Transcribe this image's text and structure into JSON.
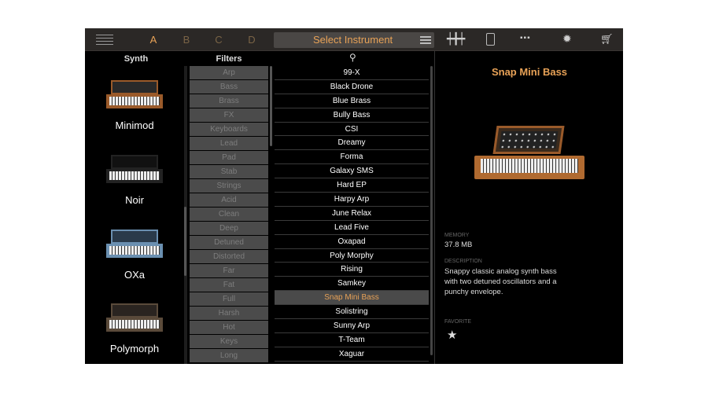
{
  "topbar": {
    "menu_icon": "menu-lines-icon",
    "preset_tabs": [
      "A",
      "B",
      "C",
      "D"
    ],
    "active_tab": "A",
    "select_instrument": "Select Instrument",
    "icons": [
      "list-icon",
      "mixer-sliders-icon",
      "pedal-icon",
      "arpeggiator-icon",
      "gear-icon",
      "cart-icon"
    ],
    "accent_color": "#e8a257"
  },
  "synth_column": {
    "header": "Synth",
    "items": [
      "Minimod",
      "Noir",
      "OXa",
      "Polymorph"
    ]
  },
  "filters": {
    "header": "Filters",
    "items": [
      "Arp",
      "Bass",
      "Brass",
      "FX",
      "Keyboards",
      "Lead",
      "Pad",
      "Stab",
      "Strings",
      "Acid",
      "Clean",
      "Deep",
      "Detuned",
      "Distorted",
      "Far",
      "Fat",
      "Full",
      "Harsh",
      "Hot",
      "Keys",
      "Long"
    ]
  },
  "instruments": {
    "search_icon": "search-icon",
    "items": [
      "99-X",
      "Black Drone",
      "Blue Brass",
      "Bully Bass",
      "CSI",
      "Dreamy",
      "Forma",
      "Galaxy SMS",
      "Hard EP",
      "Harpy Arp",
      "June Relax",
      "Lead Five",
      "Oxapad",
      "Poly Morphy",
      "Rising",
      "Samkey",
      "Snap Mini Bass",
      "Solistring",
      "Sunny Arp",
      "T-Team",
      "Xaguar"
    ],
    "selected": "Snap Mini Bass"
  },
  "detail": {
    "title": "Snap Mini Bass",
    "memory_label": "MEMORY",
    "memory": "37.8 MB",
    "description_label": "DESCRIPTION",
    "description": "Snappy classic analog synth bass with two detuned oscillators and a punchy envelope.",
    "favorite_label": "FAVORITE",
    "favorite_icon": "star-icon"
  }
}
